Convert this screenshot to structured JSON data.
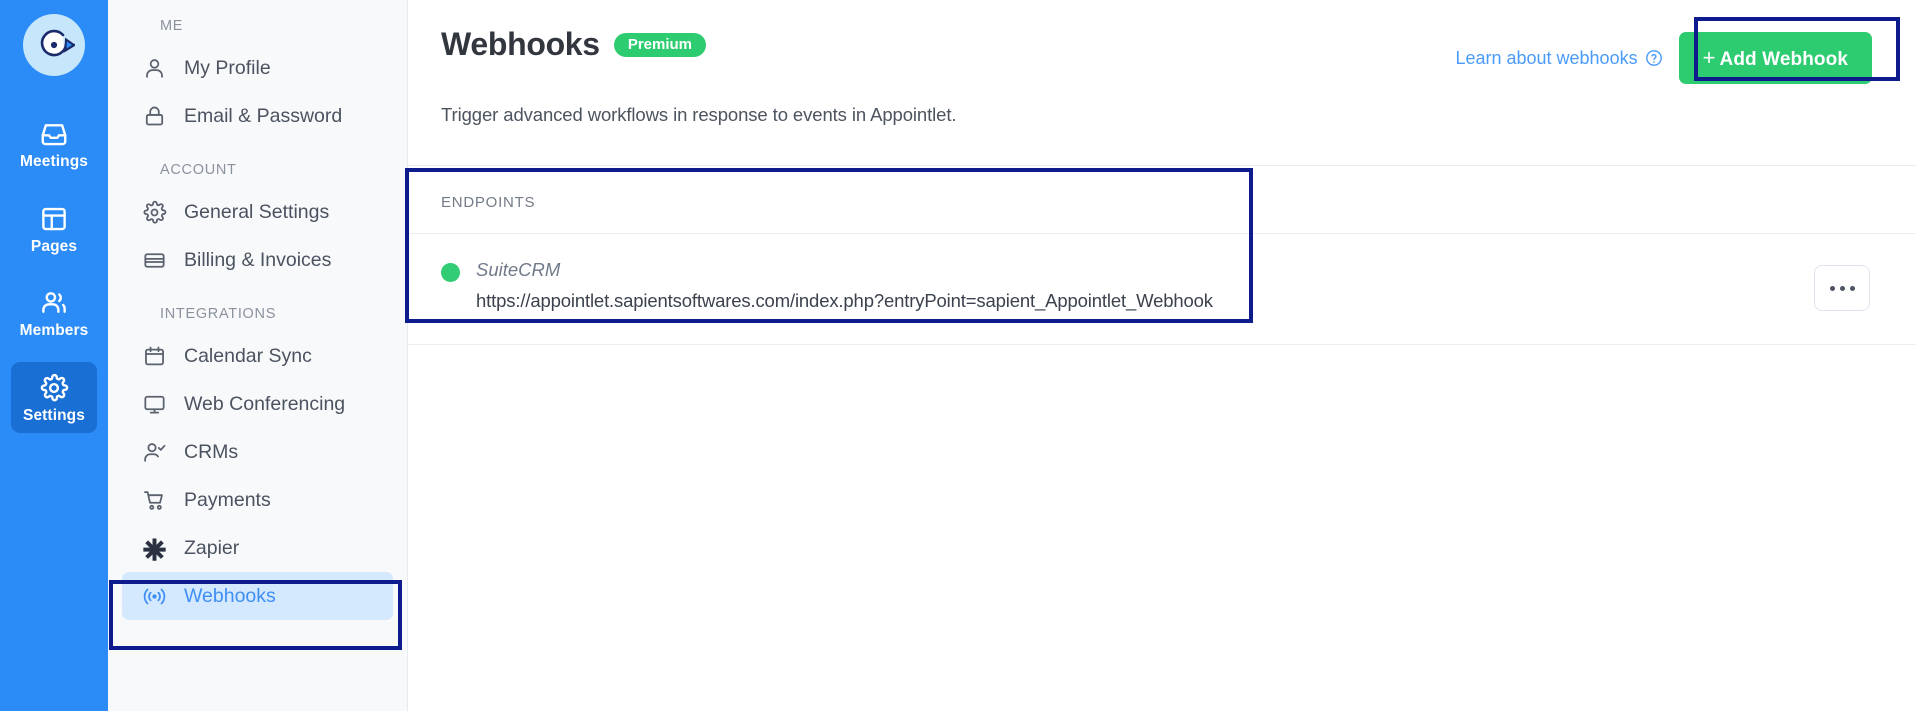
{
  "brand": {
    "logo_name": "appointlet-logo",
    "rail_color": "#2b8cf7",
    "rail_active_color": "#1a6fd4",
    "accent_green": "#2ecc71",
    "link_blue": "#4a9bfa",
    "highlight_box_color": "#0d1b8c"
  },
  "rail": {
    "items": [
      {
        "label": "Meetings",
        "icon": "inbox-icon",
        "active": false
      },
      {
        "label": "Pages",
        "icon": "layout-icon",
        "active": false
      },
      {
        "label": "Members",
        "icon": "members-icon",
        "active": false
      },
      {
        "label": "Settings",
        "icon": "gear-icon",
        "active": true
      }
    ]
  },
  "sidebar": {
    "groups": [
      {
        "title": "ME",
        "items": [
          {
            "label": "My Profile",
            "icon": "person-icon",
            "selected": false
          },
          {
            "label": "Email & Password",
            "icon": "lock-icon",
            "selected": false
          }
        ]
      },
      {
        "title": "ACCOUNT",
        "items": [
          {
            "label": "General Settings",
            "icon": "gear-icon",
            "selected": false
          },
          {
            "label": "Billing & Invoices",
            "icon": "credit-card-icon",
            "selected": false
          }
        ]
      },
      {
        "title": "INTEGRATIONS",
        "items": [
          {
            "label": "Calendar Sync",
            "icon": "calendar-icon",
            "selected": false
          },
          {
            "label": "Web Conferencing",
            "icon": "monitor-icon",
            "selected": false
          },
          {
            "label": "CRMs",
            "icon": "person-check-icon",
            "selected": false
          },
          {
            "label": "Payments",
            "icon": "cart-icon",
            "selected": false
          },
          {
            "label": "Zapier",
            "icon": "asterisk-icon",
            "selected": false
          },
          {
            "label": "Webhooks",
            "icon": "broadcast-icon",
            "selected": true
          }
        ]
      }
    ]
  },
  "header": {
    "title": "Webhooks",
    "badge": "Premium",
    "subtitle": "Trigger advanced workflows in response to events in Appointlet.",
    "learn_link": "Learn about webhooks",
    "help_icon": "question-circle-icon",
    "add_button": "Add Webhook",
    "add_button_plus": "+"
  },
  "endpoints": {
    "section_label": "ENDPOINTS",
    "rows": [
      {
        "status": "active",
        "status_color": "#31cc74",
        "name": "SuiteCRM",
        "url": "https://appointlet.sapientsoftwares.com/index.php?entryPoint=sapient_Appointlet_Webhook",
        "menu_icon": "ellipsis-icon"
      }
    ]
  },
  "annotations": [
    {
      "name": "add-webhook-button-highlight"
    },
    {
      "name": "endpoints-card-highlight"
    },
    {
      "name": "sidebar-webhooks-highlight"
    }
  ]
}
